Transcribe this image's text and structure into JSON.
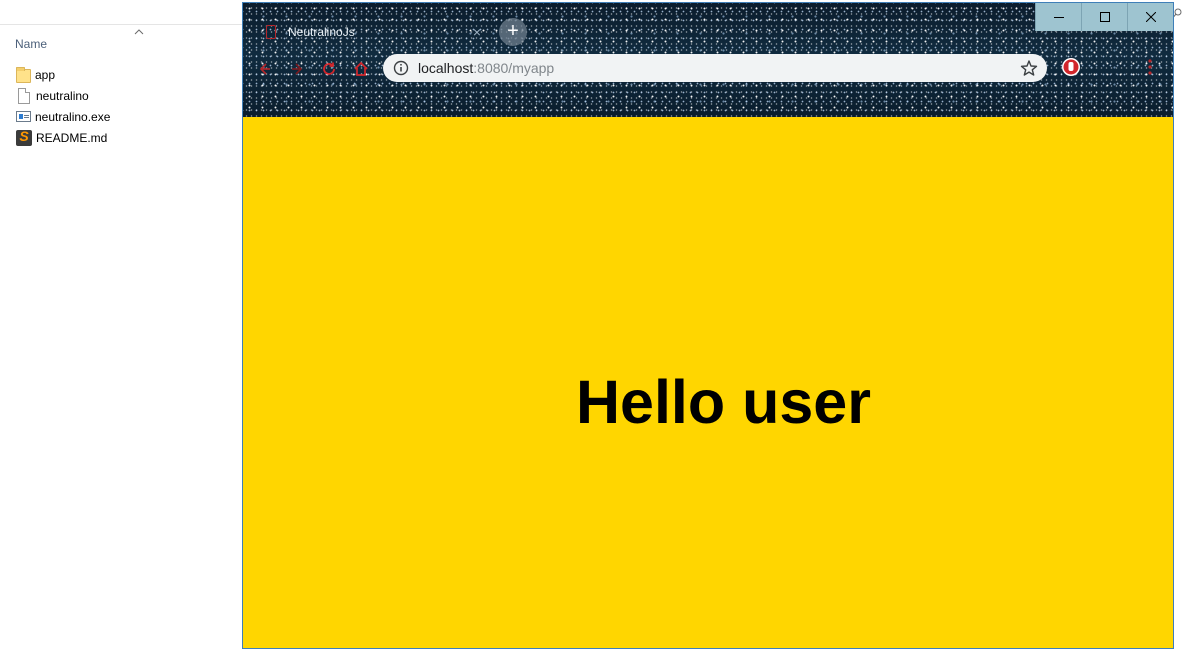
{
  "explorer": {
    "column_header": "Name",
    "files": [
      {
        "name": "app",
        "icon": "folder-icon"
      },
      {
        "name": "neutralino",
        "icon": "file-icon"
      },
      {
        "name": "neutralino.exe",
        "icon": "exe-icon"
      },
      {
        "name": "README.md",
        "icon": "sublime-text-icon"
      }
    ]
  },
  "browser": {
    "tab": {
      "title": "NeutralinoJs",
      "close": "×"
    },
    "new_tab": "+",
    "address": {
      "host": "localhost",
      "path": ":8080/myapp"
    }
  },
  "page": {
    "greeting": "Hello user"
  },
  "colors": {
    "page_background": "#ffd600",
    "window_border": "#3f7fb8",
    "nav_icon_red": "#b5262a",
    "window_controls": "#9ec4d0"
  }
}
